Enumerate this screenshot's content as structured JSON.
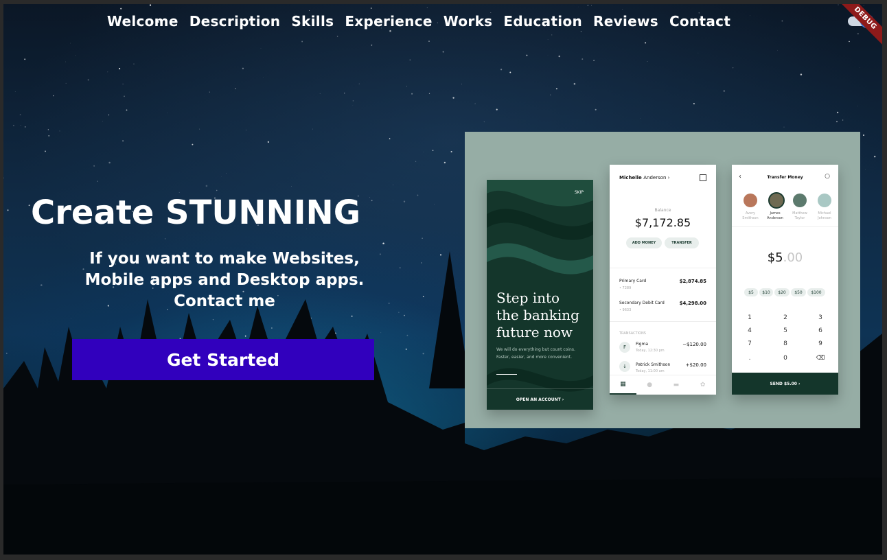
{
  "nav": {
    "items": [
      {
        "label": "Welcome"
      },
      {
        "label": "Description"
      },
      {
        "label": "Skills"
      },
      {
        "label": "Experience"
      },
      {
        "label": "Works"
      },
      {
        "label": "Education"
      },
      {
        "label": "Reviews"
      },
      {
        "label": "Contact"
      }
    ]
  },
  "debug_banner": "DEBUG",
  "hero": {
    "title": "Create STUNNING",
    "subtitle_lines": [
      "If you want to make Websites,",
      "Mobile apps and Desktop apps.",
      "Contact me"
    ],
    "cta_label": "Get Started"
  },
  "showcase": {
    "phone1": {
      "skip": "SKIP",
      "headline": "Step into the banking future now",
      "description": "We will do everything but count coins. Faster, easier, and more convenient.",
      "cta": "OPEN AN ACCOUNT  ›"
    },
    "phone2": {
      "user_first": "Michelle",
      "user_last": "Anderson ›",
      "balance_label": "Balance",
      "balance": "$7,172.85",
      "add_money": "ADD MONEY",
      "transfer": "TRANSFER",
      "cards": [
        {
          "name": "Primary Card",
          "number": "• 7289",
          "value": "$2,874.85"
        },
        {
          "name": "Secondary Debit Card",
          "number": "• 9633",
          "value": "$4,298.00"
        }
      ],
      "transactions_label": "TRANSACTIONS",
      "transactions": [
        {
          "name": "Figma",
          "time": "Today, 12:30 pm",
          "value": "−$120.00",
          "icon": "F"
        },
        {
          "name": "Patrick Smithson",
          "time": "Today, 11:00 am",
          "value": "+$20.00",
          "icon": "↓"
        }
      ]
    },
    "phone3": {
      "title": "Transfer Money",
      "contacts": [
        {
          "name": "Avery Smithson"
        },
        {
          "name": "James Anderson"
        },
        {
          "name": "Matthew Taylor"
        },
        {
          "name": "Michael Johnson"
        }
      ],
      "amount": "$5",
      "amount_dim": ".00",
      "chips": [
        "$5",
        "$10",
        "$20",
        "$50",
        "$100"
      ],
      "keypad": [
        "1",
        "2",
        "3",
        "4",
        "5",
        "6",
        "7",
        "8",
        "9",
        ".",
        "0",
        "⌫"
      ],
      "send": "SEND $5.00  ›"
    }
  },
  "colors": {
    "cta_bg": "#3100bd",
    "showcase_bg": "#96ada5",
    "phone_dark": "#14362b",
    "debug_banner": "#8e1a1a"
  }
}
